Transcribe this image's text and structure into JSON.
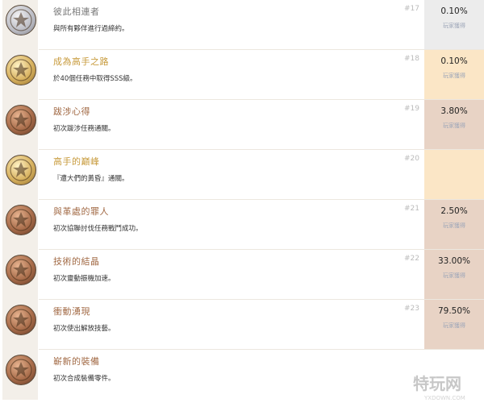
{
  "achievements": [
    {
      "title": "彼此相連者",
      "title_color": "#7a7a7a",
      "desc": "與所有夥伴進行過締約。",
      "num": "#17",
      "pct": "0.10%",
      "sub": "玩家獲得",
      "medal": "silver",
      "rate_bg": "#ececec",
      "badge_icon": "silver-medal-icon"
    },
    {
      "title": "成為高手之路",
      "title_color": "#c79a3b",
      "desc": "於40個任務中取得SSS級。",
      "num": "#18",
      "pct": "0.10%",
      "sub": "玩家獲得",
      "medal": "gold",
      "rate_bg": "#fbe6c6",
      "badge_icon": "gold-medal-icon"
    },
    {
      "title": "跋涉心得",
      "title_color": "#a26a45",
      "desc": "初次跋涉任務通關。",
      "num": "#19",
      "pct": "3.80%",
      "sub": "玩家獲得",
      "medal": "bronze",
      "rate_bg": "#e8d3c5",
      "badge_icon": "bronze-medal-icon"
    },
    {
      "title": "高手的巔峰",
      "title_color": "#c79a3b",
      "desc": "『遭大們的黃昏』通關。",
      "num": "#20",
      "pct": "",
      "sub": "",
      "medal": "gold",
      "rate_bg": "#fbe6c6",
      "badge_icon": "gold-medal-icon"
    },
    {
      "title": "與革處的罪人",
      "title_color": "#a26a45",
      "desc": "初次協聯討伐任務戰鬥成功。",
      "num": "#21",
      "pct": "2.50%",
      "sub": "玩家獲得",
      "medal": "bronze",
      "rate_bg": "#e8d3c5",
      "badge_icon": "bronze-medal-icon"
    },
    {
      "title": "技術的結晶",
      "title_color": "#a26a45",
      "desc": "初次靈動振機加速。",
      "num": "#22",
      "pct": "33.00%",
      "sub": "玩家獲得",
      "medal": "bronze",
      "rate_bg": "#e8d3c5",
      "badge_icon": "bronze-medal-icon"
    },
    {
      "title": "衝動湧現",
      "title_color": "#a26a45",
      "desc": "初次使出解放技藝。",
      "num": "#23",
      "pct": "79.50%",
      "sub": "玩家獲得",
      "medal": "bronze",
      "rate_bg": "#e8d3c5",
      "badge_icon": "bronze-medal-icon"
    },
    {
      "title": "嶄新的裝備",
      "title_color": "#a26a45",
      "desc": "初次合成裝備零件。",
      "num": "",
      "pct": "",
      "sub": "",
      "medal": "bronze",
      "rate_bg": "#ffffff",
      "badge_icon": "bronze-medal-icon"
    }
  ],
  "watermark": {
    "text": "特玩网",
    "sub": "YXDOWN.COM"
  }
}
